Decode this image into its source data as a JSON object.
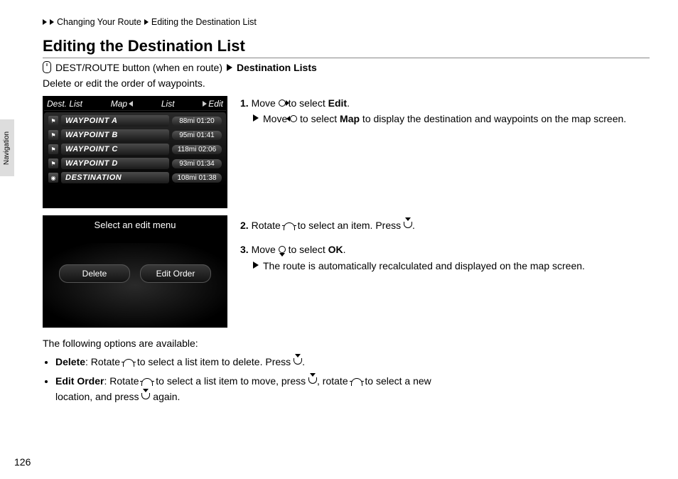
{
  "breadcrumb": {
    "a": "Changing Your Route",
    "b": "Editing the Destination List"
  },
  "title": "Editing the Destination List",
  "path": {
    "button": "DEST/ROUTE button (when en route)",
    "end": "Destination Lists"
  },
  "intro": "Delete or edit the order of waypoints.",
  "sideTab": "Navigation",
  "pageNumber": "126",
  "screen1": {
    "headTitle": "Dest. List",
    "tabMap": "Map",
    "tabList": "List",
    "tabEdit": "Edit",
    "rows": [
      {
        "name": "WAYPOINT A",
        "dist": "88mi 01:20"
      },
      {
        "name": "WAYPOINT B",
        "dist": "95mi 01:41"
      },
      {
        "name": "WAYPOINT C",
        "dist": "118mi 02:06"
      },
      {
        "name": "WAYPOINT D",
        "dist": "93mi 01:34"
      },
      {
        "name": "DESTINATION",
        "dist": "108mi 01:38"
      }
    ]
  },
  "screen2": {
    "title": "Select an edit menu",
    "btnDelete": "Delete",
    "btnEditOrder": "Edit Order"
  },
  "steps": {
    "s1a": "Move ",
    "s1b": " to select ",
    "s1c": "Edit",
    "s1d": ".",
    "s1sub_a": "Move ",
    "s1sub_b": " to select ",
    "s1sub_c": "Map",
    "s1sub_d": " to display the destination and waypoints on the map screen.",
    "s2a": "Rotate ",
    "s2b": " to select an item. Press ",
    "s2c": ".",
    "s3a": "Move ",
    "s3b": " to select ",
    "s3c": "OK",
    "s3d": ".",
    "s3sub": "The route is automatically recalculated and displayed on the map screen."
  },
  "follow": {
    "lead": "The following options are available:",
    "del_label": "Delete",
    "del_a": ": Rotate ",
    "del_b": " to select a list item to delete. Press ",
    "del_c": ".",
    "eo_label": "Edit Order",
    "eo_a": ": Rotate ",
    "eo_b": " to select a list item to move, press ",
    "eo_c": ", rotate ",
    "eo_d": " to select a new location, and press ",
    "eo_e": " again."
  }
}
